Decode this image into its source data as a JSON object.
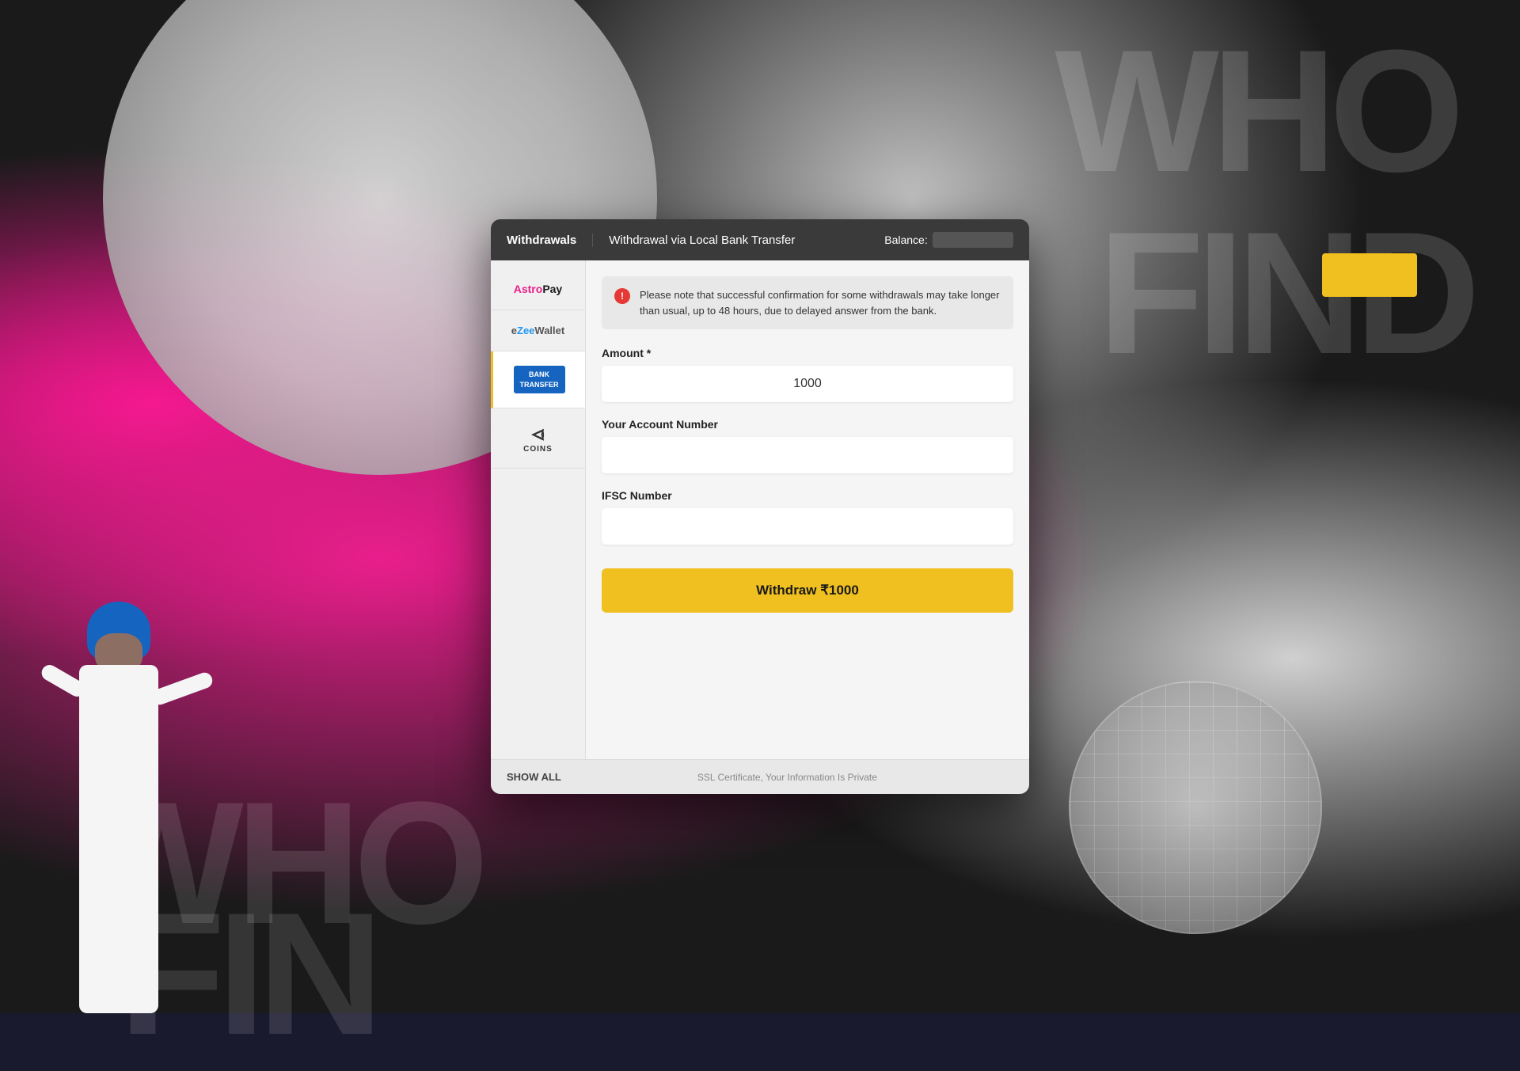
{
  "background": {
    "text1": "WHO",
    "text2": "FIND",
    "text3": "WHO",
    "text4": "FIN"
  },
  "header": {
    "tab_withdrawals": "Withdrawals",
    "title": "Withdrawal via Local Bank Transfer",
    "balance_label": "Balance:",
    "balance_value": "■■■■■"
  },
  "sidebar": {
    "items": [
      {
        "id": "astropay",
        "label": "AstroPay",
        "active": false
      },
      {
        "id": "ezeewallet",
        "label": "eZeeWallet",
        "active": false
      },
      {
        "id": "bank-transfer",
        "label": "BANK TRANSFER",
        "active": true
      },
      {
        "id": "coins",
        "label": "COINS",
        "active": false
      }
    ],
    "show_all": "SHOW ALL"
  },
  "notice": {
    "text": "Please note that successful confirmation for some withdrawals may take longer than usual, up to 48 hours, due to delayed answer from the bank."
  },
  "form": {
    "amount_label": "Amount *",
    "amount_value": "1000",
    "account_label": "Your Account Number",
    "account_placeholder": "",
    "ifsc_label": "IFSC Number",
    "ifsc_placeholder": "",
    "submit_label": "Withdraw ₹1000"
  },
  "footer": {
    "ssl_text": "SSL Certificate, Your Information Is Private"
  }
}
